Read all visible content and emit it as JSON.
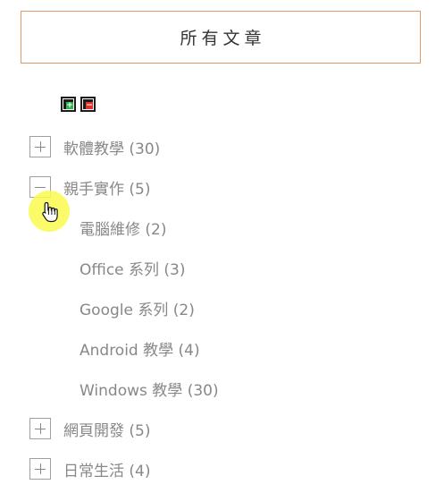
{
  "panel": {
    "title": "所有文章"
  },
  "controls": {
    "expand_all_icon": "expand-all-icon",
    "collapse_all_icon": "collapse-all-icon"
  },
  "categories": [
    {
      "label": "軟體教學 (30)",
      "state": "collapsed",
      "children": []
    },
    {
      "label": "親手實作 (5)",
      "state": "expanded",
      "children": [
        {
          "label": "電腦維修 (2)"
        },
        {
          "label": "Office 系列 (3)"
        },
        {
          "label": "Google 系列 (2)"
        },
        {
          "label": "Android 教學 (4)"
        },
        {
          "label": "Windows 教學 (30)"
        }
      ]
    },
    {
      "label": "網頁開發 (5)",
      "state": "collapsed",
      "children": []
    },
    {
      "label": "日常生活 (4)",
      "state": "collapsed",
      "children": []
    }
  ],
  "colors": {
    "accent_border": "#e09a6a",
    "text_muted": "#888888",
    "title_text": "#333333",
    "expand_green": "#2fb34a",
    "collapse_red": "#e0302a",
    "cursor_highlight": "#fafa50"
  }
}
